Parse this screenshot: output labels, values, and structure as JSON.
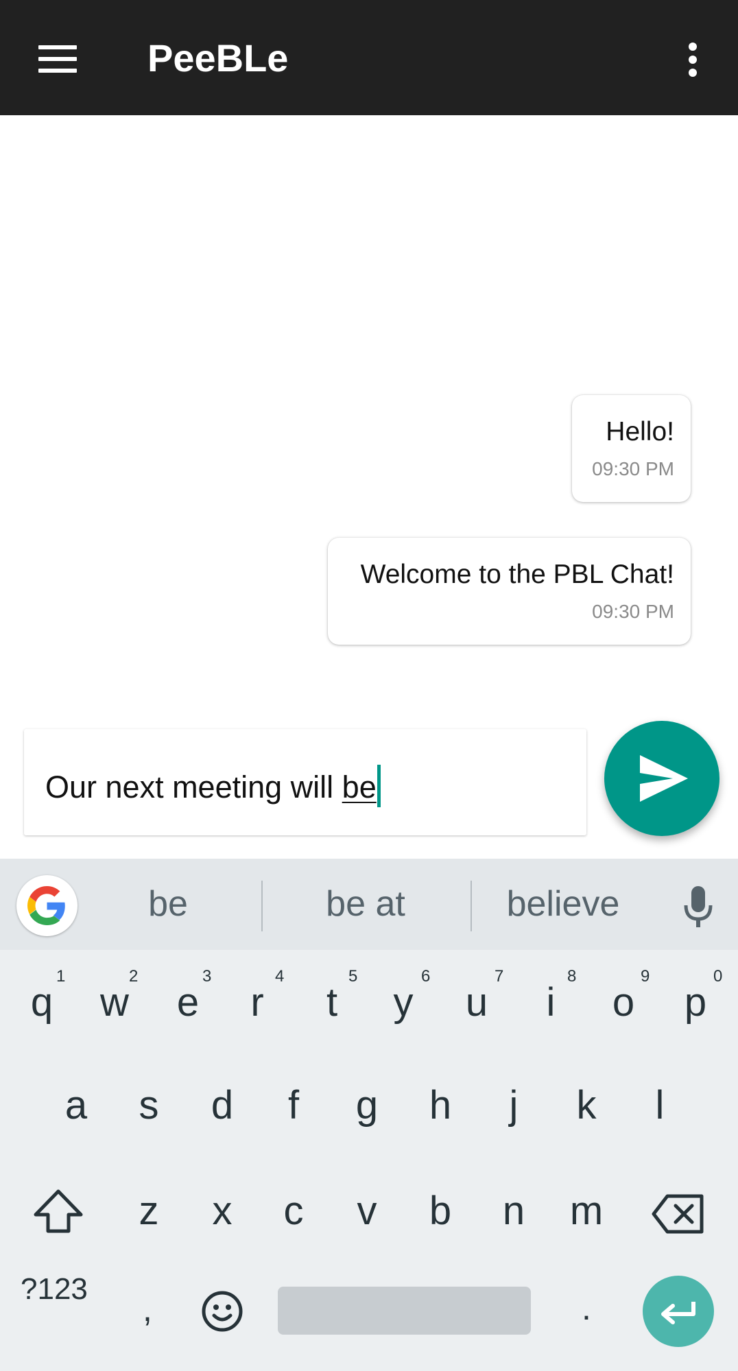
{
  "app_bar": {
    "title": "PeeBLe"
  },
  "messages": [
    {
      "text": "Hello!",
      "time": "09:30 PM"
    },
    {
      "text": "Welcome to the PBL Chat!",
      "time": "09:30 PM"
    }
  ],
  "composer": {
    "text_before": "Our next meeting will ",
    "composing_word": "be"
  },
  "colors": {
    "accent": "#009688",
    "app_bar": "#212121"
  },
  "keyboard": {
    "suggestions": [
      "be",
      "be at",
      "believe"
    ],
    "row1": [
      "q",
      "w",
      "e",
      "r",
      "t",
      "y",
      "u",
      "i",
      "o",
      "p"
    ],
    "row1_hints": [
      "1",
      "2",
      "3",
      "4",
      "5",
      "6",
      "7",
      "8",
      "9",
      "0"
    ],
    "row2": [
      "a",
      "s",
      "d",
      "f",
      "g",
      "h",
      "j",
      "k",
      "l"
    ],
    "row3": [
      "z",
      "x",
      "c",
      "v",
      "b",
      "n",
      "m"
    ],
    "symbols_label": "?123",
    "comma": ",",
    "period": "."
  },
  "icons": [
    "menu-icon",
    "more-vert-icon",
    "send-icon",
    "google-icon",
    "mic-icon",
    "shift-icon",
    "backspace-icon",
    "emoji-icon",
    "enter-icon"
  ]
}
